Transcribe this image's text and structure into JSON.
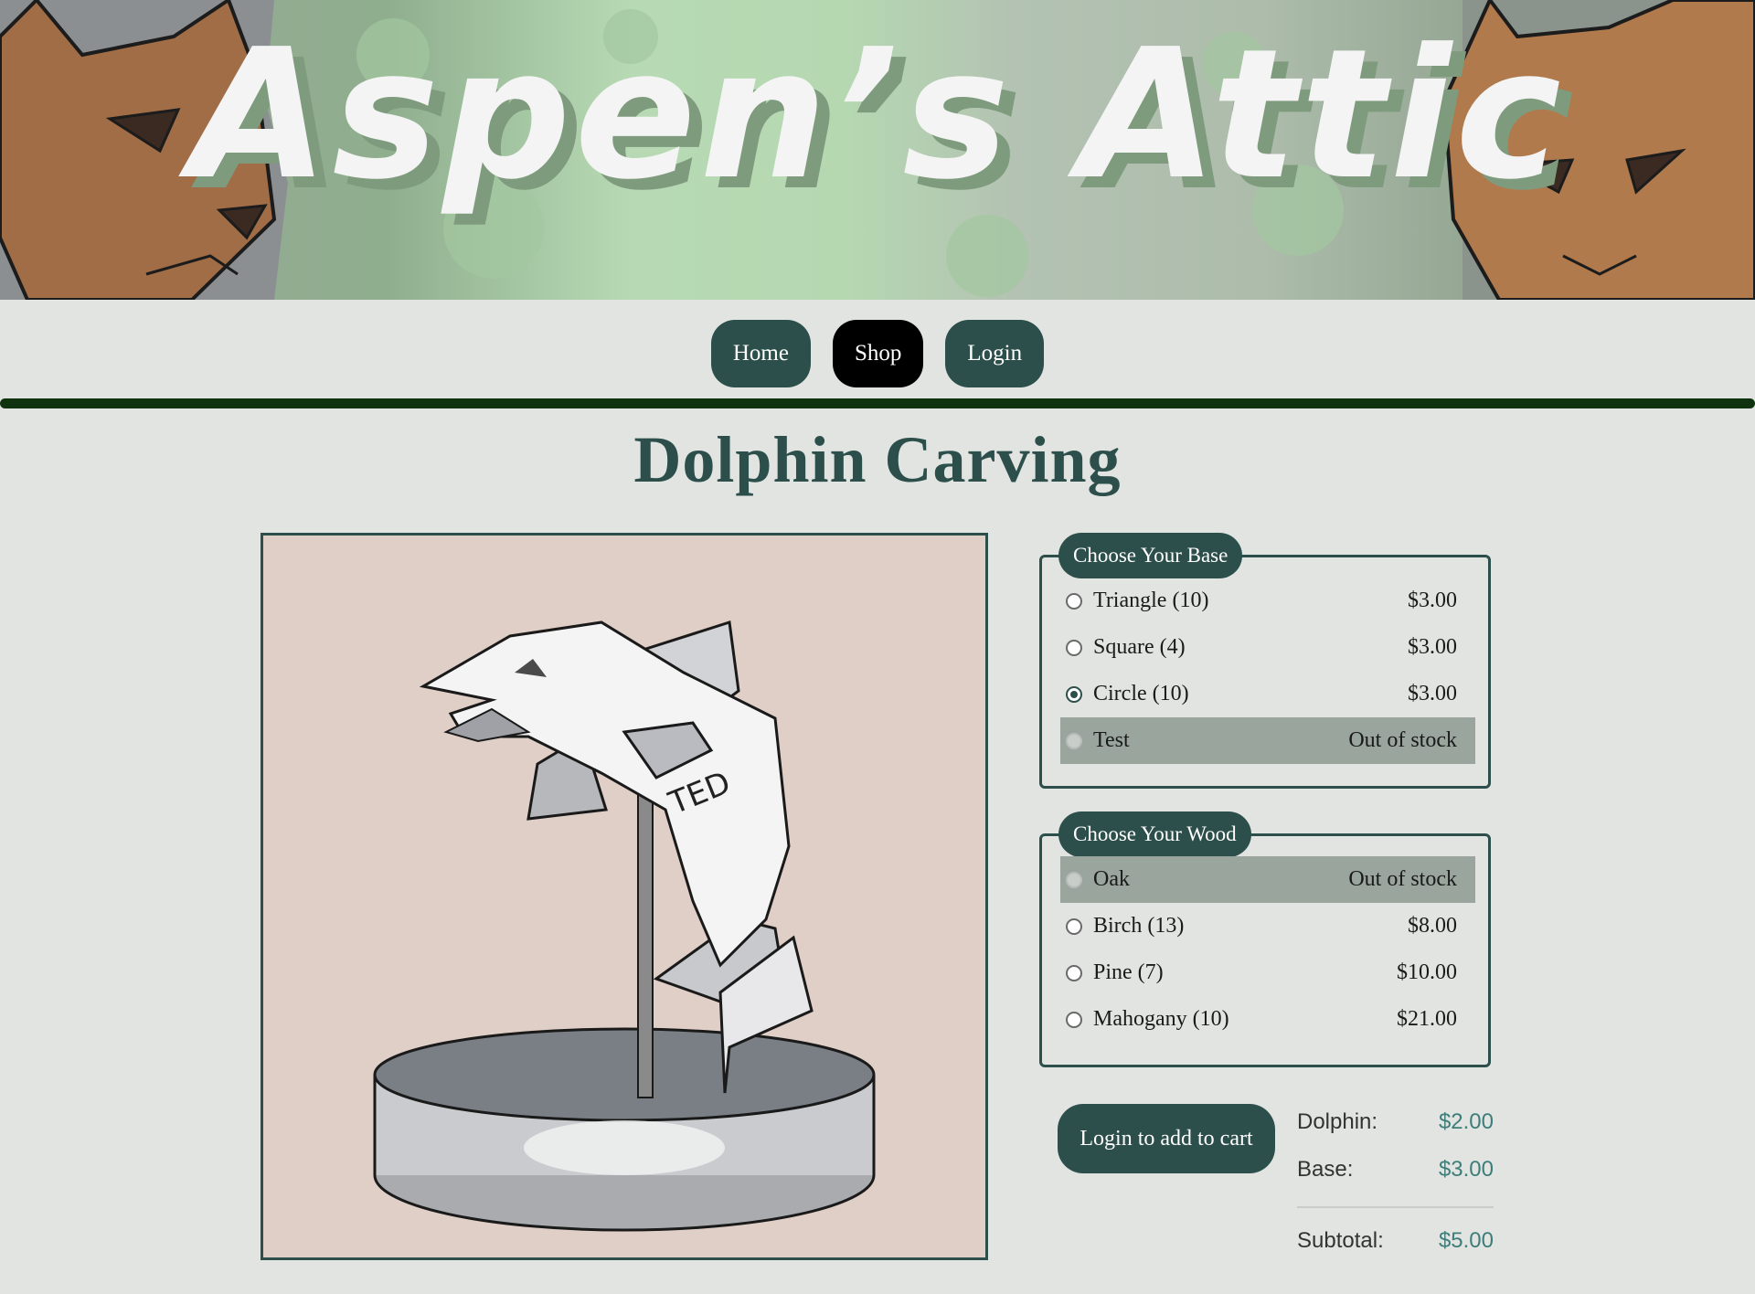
{
  "banner": {
    "title": "Aspen’s Attic"
  },
  "nav": {
    "items": [
      {
        "label": "Home",
        "active": false
      },
      {
        "label": "Shop",
        "active": true
      },
      {
        "label": "Login",
        "active": false
      }
    ]
  },
  "page": {
    "title": "Dolphin Carving"
  },
  "product": {
    "image_text": "TED"
  },
  "base": {
    "legend": "Choose Your Base",
    "options": [
      {
        "label": "Triangle (10)",
        "price": "$3.00",
        "checked": false,
        "disabled": false
      },
      {
        "label": "Square (4)",
        "price": "$3.00",
        "checked": false,
        "disabled": false
      },
      {
        "label": "Circle (10)",
        "price": "$3.00",
        "checked": true,
        "disabled": false
      },
      {
        "label": "Test",
        "price": "Out of stock",
        "checked": false,
        "disabled": true
      }
    ]
  },
  "wood": {
    "legend": "Choose Your Wood",
    "options": [
      {
        "label": "Oak",
        "price": "Out of stock",
        "checked": false,
        "disabled": true
      },
      {
        "label": "Birch (13)",
        "price": "$8.00",
        "checked": false,
        "disabled": false
      },
      {
        "label": "Pine (7)",
        "price": "$10.00",
        "checked": false,
        "disabled": false
      },
      {
        "label": "Mahogany (10)",
        "price": "$21.00",
        "checked": false,
        "disabled": false
      }
    ]
  },
  "cart": {
    "button_label": "Login to add to cart",
    "lines": [
      {
        "label": "Dolphin:",
        "value": "$2.00"
      },
      {
        "label": "Base:",
        "value": "$3.00"
      }
    ],
    "subtotal": {
      "label": "Subtotal:",
      "value": "$5.00"
    }
  },
  "colors": {
    "primary": "#2c4f4b",
    "page_bg": "#e2e4e1",
    "divider": "#10330f",
    "disabled_row": "#9aa59e",
    "price_text": "#3d7d7a"
  }
}
